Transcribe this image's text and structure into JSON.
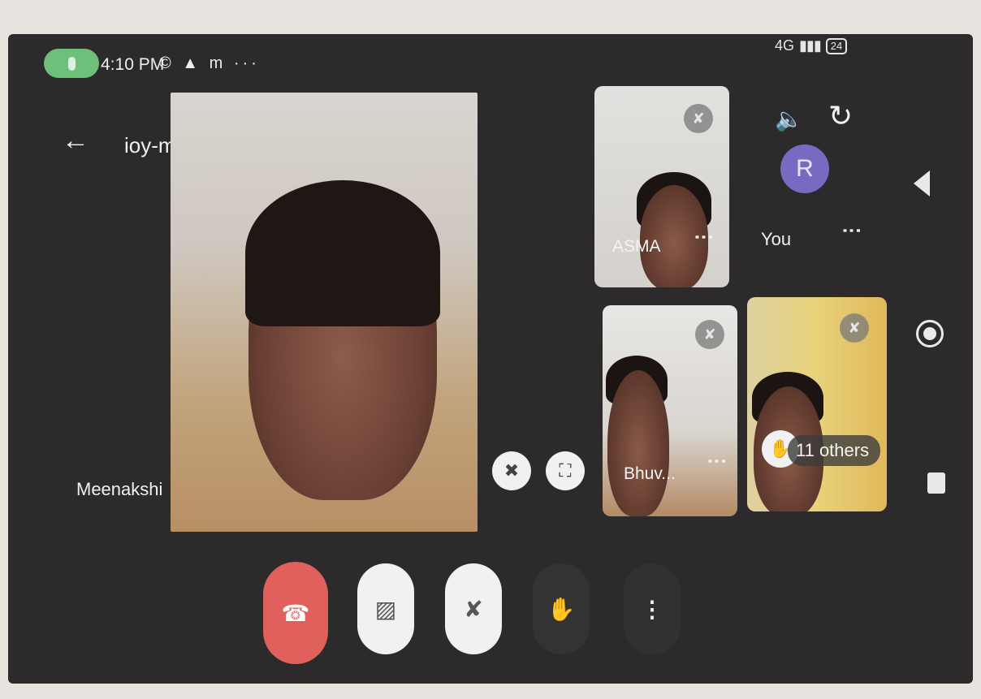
{
  "status_bar": {
    "time": "4:10 PM",
    "notification_icons": "© ▲ m ···",
    "signal": "4G",
    "battery": "24"
  },
  "header": {
    "meeting_code": "ioy-mbzy-djz"
  },
  "main_video": {
    "participant_name": "Meenakshi"
  },
  "participants": [
    {
      "name": "ASMA"
    },
    {
      "name": "You",
      "avatar_letter": "R"
    },
    {
      "name": "Bhuv..."
    },
    {
      "name": "11 others"
    }
  ],
  "icons": {
    "back": "←",
    "dropdown": "▸",
    "speaker": "🔈",
    "flip": "↻",
    "unpin": "✖",
    "fullscreen": "⛶",
    "end_call": "☎",
    "camera_off": "▨",
    "mic_off": "✘",
    "raise_hand": "✋",
    "more": "⋮",
    "muted": "✘"
  },
  "colors": {
    "end_call": "#e0605c",
    "avatar": "#7a69c2",
    "status_mic": "#6cc07a"
  }
}
